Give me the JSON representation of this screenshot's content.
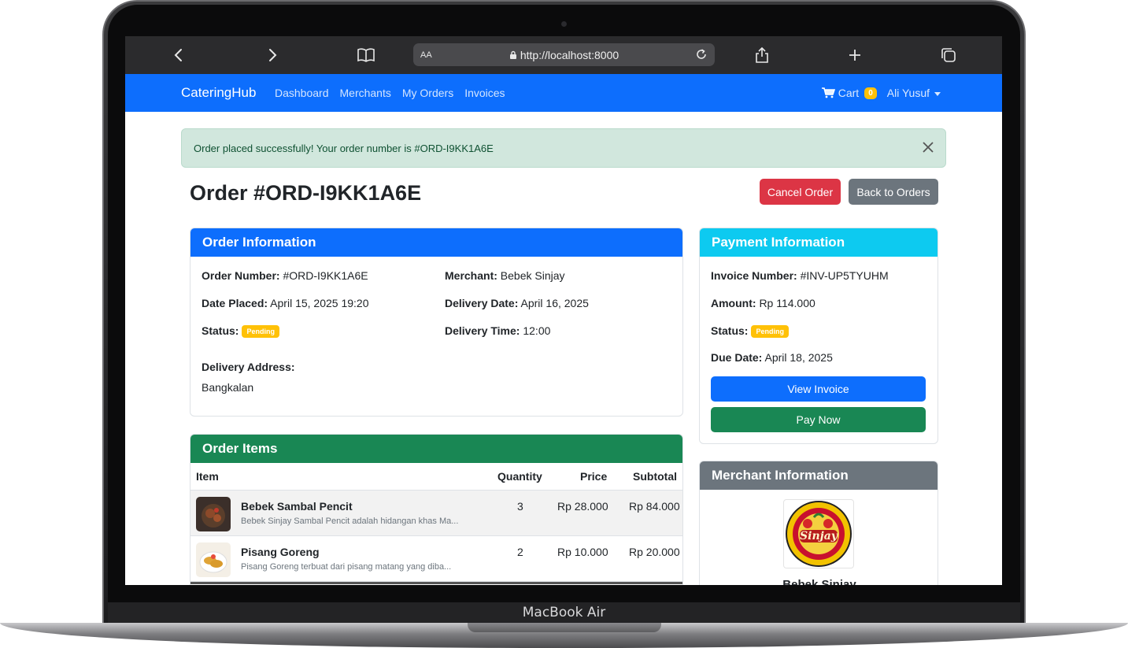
{
  "device": {
    "brand": "MacBook Air"
  },
  "browser": {
    "url": "http://localhost:8000",
    "text_size_label": "AA"
  },
  "navbar": {
    "brand": "CateringHub",
    "links": [
      "Dashboard",
      "Merchants",
      "My Orders",
      "Invoices"
    ],
    "cart_label": "Cart",
    "cart_count": "0",
    "user_name": "Ali Yusuf"
  },
  "alert": {
    "message": "Order placed successfully! Your order number is #ORD-I9KK1A6E"
  },
  "page": {
    "title": "Order #ORD-I9KK1A6E",
    "cancel_label": "Cancel Order",
    "back_label": "Back to Orders"
  },
  "order_info": {
    "header": "Order Information",
    "order_number_label": "Order Number:",
    "order_number": "#ORD-I9KK1A6E",
    "merchant_label": "Merchant:",
    "merchant": "Bebek Sinjay",
    "date_placed_label": "Date Placed:",
    "date_placed": "April 15, 2025 19:20",
    "delivery_date_label": "Delivery Date:",
    "delivery_date": "April 16, 2025",
    "status_label": "Status:",
    "status": "Pending",
    "delivery_time_label": "Delivery Time:",
    "delivery_time": "12:00",
    "address_label": "Delivery Address:",
    "address": "Bangkalan"
  },
  "payment_info": {
    "header": "Payment Information",
    "invoice_label": "Invoice Number:",
    "invoice_number": "#INV-UP5TYUHM",
    "amount_label": "Amount:",
    "amount": "Rp 114.000",
    "status_label": "Status:",
    "status": "Pending",
    "due_label": "Due Date:",
    "due_date": "April 18, 2025",
    "view_invoice_label": "View Invoice",
    "pay_now_label": "Pay Now"
  },
  "order_items": {
    "header": "Order Items",
    "columns": [
      "Item",
      "Quantity",
      "Price",
      "Subtotal"
    ],
    "rows": [
      {
        "name": "Bebek Sambal Pencit",
        "description": "Bebek Sinjay Sambal Pencit adalah hidangan khas Ma...",
        "quantity": "3",
        "price": "Rp 28.000",
        "subtotal": "Rp 84.000"
      },
      {
        "name": "Pisang Goreng",
        "description": "Pisang Goreng terbuat dari pisang matang yang diba...",
        "quantity": "2",
        "price": "Rp 10.000",
        "subtotal": "Rp 20.000"
      }
    ]
  },
  "merchant_info": {
    "header": "Merchant Information",
    "logo_text": "Sinjay",
    "name_partial": "Bebek Sinjay"
  },
  "colors": {
    "primary": "#0d6efd",
    "info": "#0dcaf0",
    "success": "#198754",
    "danger": "#dc3545",
    "secondary": "#6c757d",
    "warning": "#ffc107"
  }
}
